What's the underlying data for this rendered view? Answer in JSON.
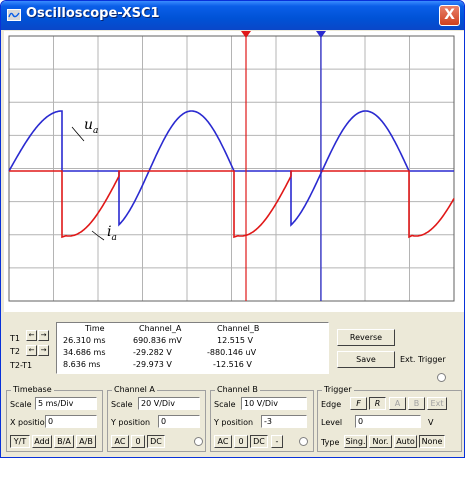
{
  "window": {
    "title": "Oscilloscope-XSC1",
    "close_label": "X"
  },
  "waveform_labels": {
    "upper": "u",
    "upper_sub": "a",
    "lower": "i",
    "lower_sub": "a"
  },
  "colors": {
    "channel_a": "#2a2ad0",
    "channel_b": "#e01818",
    "cursor1": "#e01818",
    "cursor2": "#2a2ad0"
  },
  "cursors": {
    "t1_label": "T1",
    "t2_label": "T2",
    "t2t1_label": "T2-T1",
    "t1_arrow_left": "←",
    "t1_arrow_right": "→",
    "t2_arrow_left": "←",
    "t2_arrow_right": "→"
  },
  "readings": {
    "headers": [
      "Time",
      "Channel_A",
      "Channel_B"
    ],
    "rows": [
      [
        "26.310 ms",
        "690.836 mV",
        "12.515 V"
      ],
      [
        "34.686 ms",
        "-29.282 V",
        "-880.146 uV"
      ],
      [
        "8.636 ms",
        "-29.973 V",
        "-12.516 V"
      ]
    ]
  },
  "buttons": {
    "reverse": "Reverse",
    "save": "Save",
    "ext_trigger": "Ext. Trigger"
  },
  "timebase": {
    "title": "Timebase",
    "scale_label": "Scale",
    "scale_value": "5 ms/Div",
    "xpos_label": "X position",
    "xpos_value": "0",
    "modes": [
      "Y/T",
      "Add",
      "B/A",
      "A/B"
    ]
  },
  "channel_a": {
    "title": "Channel A",
    "scale_label": "Scale",
    "scale_value": "20  V/Div",
    "ypos_label": "Y position",
    "ypos_value": "0",
    "coupling": [
      "AC",
      "0",
      "DC"
    ]
  },
  "channel_b": {
    "title": "Channel B",
    "scale_label": "Scale",
    "scale_value": "10  V/Div",
    "ypos_label": "Y position",
    "ypos_value": "-3",
    "coupling": [
      "AC",
      "0",
      "DC",
      "-"
    ]
  },
  "trigger": {
    "title": "Trigger",
    "edge_label": "Edge",
    "edge_buttons": [
      "F",
      "R",
      "A",
      "B",
      "Ext"
    ],
    "level_label": "Level",
    "level_value": "0",
    "level_unit": "V",
    "type_label": "Type",
    "types": [
      "Sing.",
      "Nor.",
      "Auto",
      "None"
    ]
  },
  "chart_data": {
    "type": "line",
    "series": [
      {
        "name": "u",
        "channel": "A",
        "color": "#2a2ad0"
      },
      {
        "name": "i",
        "channel": "B",
        "color": "#e01818"
      }
    ],
    "cursor_times_ms": [
      26.31,
      34.686
    ],
    "timebase_ms_per_div": 5,
    "grid": true
  }
}
